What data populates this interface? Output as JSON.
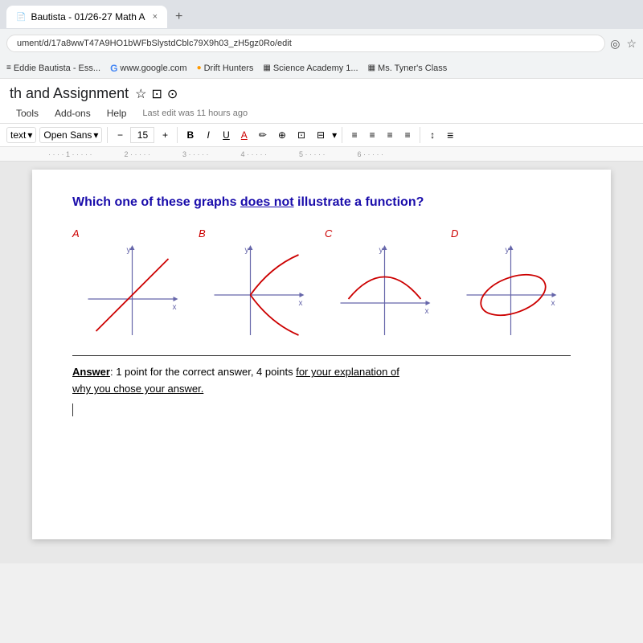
{
  "browser": {
    "tab_title": "Bautista - 01/26-27 Math A",
    "tab_close": "×",
    "tab_new": "+",
    "address_bar": "ument/d/17a8wwT47A9HO1bWFbSlystdCblc79X9h03_zH5gz0Ro/edit",
    "icon_star": "☆",
    "icon_eye": "◎"
  },
  "bookmarks": [
    {
      "icon": "≡",
      "label": "Eddie Bautista - Ess..."
    },
    {
      "icon": "G",
      "label": "www.google.com"
    },
    {
      "icon": "◉",
      "label": "Drift Hunters"
    },
    {
      "icon": "▦",
      "label": "Science Academy 1..."
    },
    {
      "icon": "▦",
      "label": "Ms. Tyner's Class"
    }
  ],
  "docs": {
    "title": "th and Assignment",
    "title_icons": [
      "☆",
      "⊡",
      "⊙"
    ],
    "menu_items": [
      "Tools",
      "Add-ons",
      "Help"
    ],
    "last_edit": "Last edit was 11 hours ago",
    "toolbar": {
      "style_dropdown": "text",
      "font_dropdown": "Open Sans",
      "minus": "−",
      "font_size": "15",
      "plus": "+",
      "bold": "B",
      "italic": "I",
      "underline": "U",
      "font_color": "A",
      "link": "⊕",
      "image1": "⊡",
      "image2": "⊟",
      "align_items": [
        "≡",
        "≡",
        "≡",
        "≡"
      ],
      "line_spacing": "↕",
      "list": "≡"
    },
    "ruler_marks": [
      "1",
      "2",
      "3",
      "4",
      "5",
      "6"
    ]
  },
  "content": {
    "question": "Which one of these graphs ",
    "question_underline": "does not",
    "question_end": " illustrate a function?",
    "graphs": [
      {
        "label": "A",
        "type": "line_diagonal"
      },
      {
        "label": "B",
        "type": "parabola_up"
      },
      {
        "label": "C",
        "type": "parabola_down"
      },
      {
        "label": "D",
        "type": "ellipse"
      }
    ],
    "answer_label": "Answer",
    "answer_text": ": 1 point for the correct answer, 4 points ",
    "answer_underline": "for your explanation of",
    "answer_text2": "why you chose your answer."
  }
}
